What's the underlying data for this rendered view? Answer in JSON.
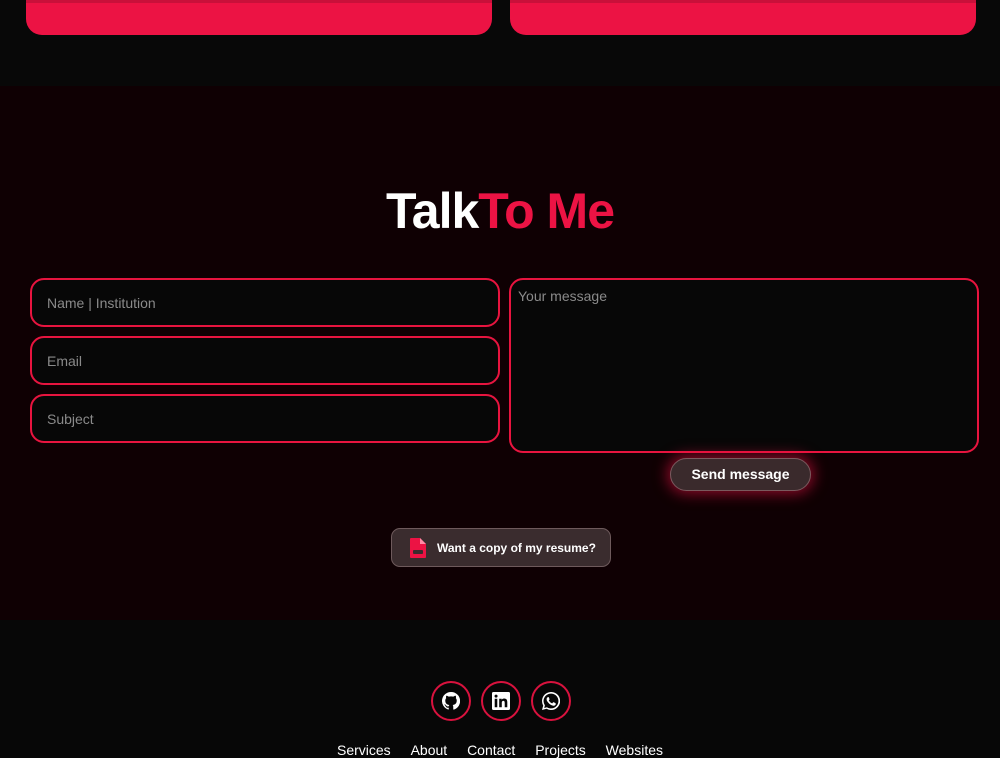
{
  "contact": {
    "title_part1": "Talk",
    "title_part2": "To Me",
    "name_placeholder": "Name | Institution",
    "email_placeholder": "Email",
    "subject_placeholder": "Subject",
    "message_placeholder": "Your message",
    "send_label": "Send message",
    "resume_label": "Want a copy of my resume?",
    "resume_icon": "pdf-file-icon"
  },
  "footer": {
    "social": [
      {
        "icon": "github-icon"
      },
      {
        "icon": "linkedin-icon"
      },
      {
        "icon": "whatsapp-icon"
      }
    ],
    "nav": [
      "Services",
      "About",
      "Contact",
      "Projects",
      "Websites"
    ]
  },
  "colors": {
    "accent": "#ec1344",
    "background": "#070707",
    "section_background": "#0f0003"
  }
}
